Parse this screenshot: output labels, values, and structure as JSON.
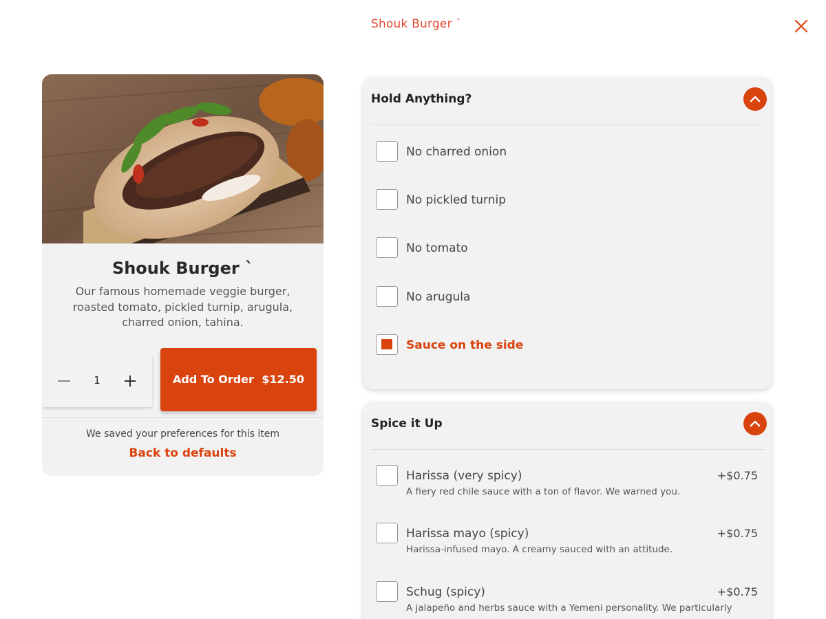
{
  "header": {
    "title": "Shouk Burger `"
  },
  "item": {
    "name": "Shouk Burger `",
    "description": "Our famous homemade veggie burger, roasted tomato, pickled turnip, arugula, charred onion, tahina.",
    "quantity": "1",
    "add_label": "Add To Order",
    "price": "$12.50",
    "saved_note": "We saved your preferences for this item",
    "back_to_defaults": "Back to defaults"
  },
  "hold": {
    "title": "Hold Anything?",
    "options": [
      {
        "label": "No charred onion",
        "checked": false
      },
      {
        "label": "No pickled turnip",
        "checked": false
      },
      {
        "label": "No tomato",
        "checked": false
      },
      {
        "label": "No arugula",
        "checked": false
      },
      {
        "label": "Sauce on the side",
        "checked": true
      }
    ]
  },
  "spice": {
    "title": "Spice it Up",
    "options": [
      {
        "label": "Harissa (very spicy)",
        "sub": "A fiery red chile sauce with a ton of flavor. We warned you.",
        "price": "+$0.75",
        "checked": false
      },
      {
        "label": "Harissa mayo (spicy)",
        "sub": "Harissa-infused mayo. A creamy sauced with an attitude.",
        "price": "+$0.75",
        "checked": false
      },
      {
        "label": "Schug (spicy)",
        "sub": "A jalapeño and herbs sauce with a Yemeni personality. We particularly",
        "price": "+$0.75",
        "checked": false
      }
    ]
  },
  "colors": {
    "accent": "#d9430d",
    "title": "#e04a2f",
    "panel": "#f2f2f2"
  },
  "icons": {
    "close": "close-icon",
    "minus": "minus-icon",
    "plus": "plus-icon",
    "collapse": "chevron-up-icon"
  }
}
